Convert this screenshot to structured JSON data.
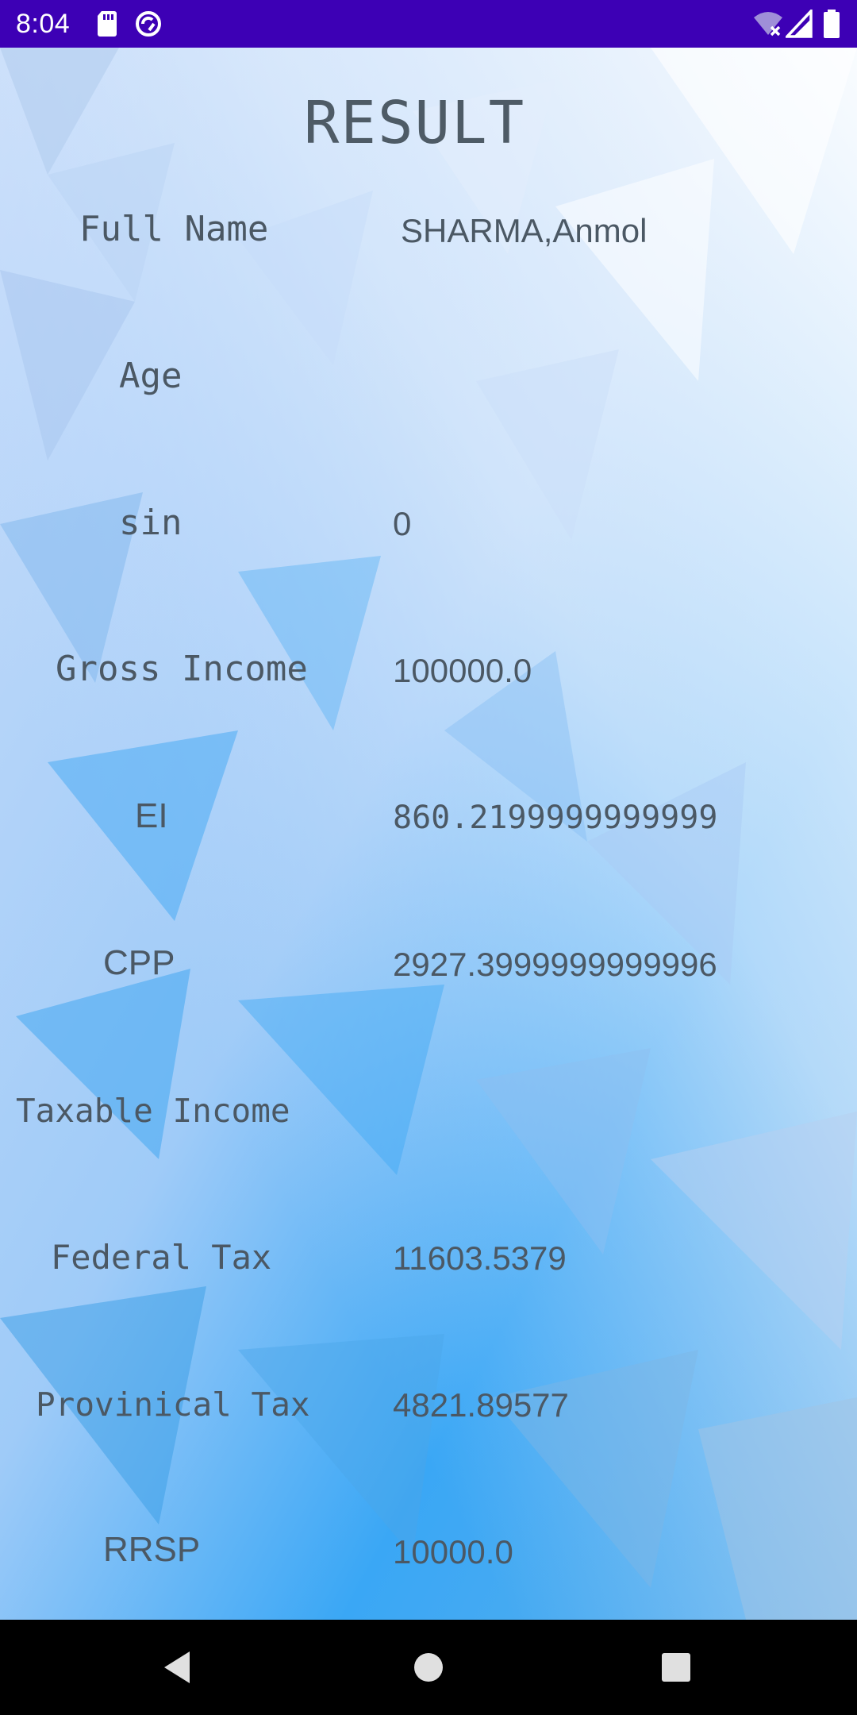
{
  "status_bar": {
    "time": "8:04",
    "icons": [
      "sd-card-icon",
      "sync-icon",
      "wifi-off-icon",
      "cell-signal-icon",
      "battery-icon"
    ]
  },
  "page": {
    "title": "RESULT"
  },
  "rows": [
    {
      "label": "Full Name",
      "value": "SHARMA,Anmol"
    },
    {
      "label": "Age",
      "value": ""
    },
    {
      "label": "sin",
      "value": "0"
    },
    {
      "label": "Gross Income",
      "value": "100000.0"
    },
    {
      "label": "EI",
      "value": "860.2199999999999"
    },
    {
      "label": "CPP",
      "value": "2927.3999999999996"
    },
    {
      "label": "Taxable Income",
      "value": ""
    },
    {
      "label": "Federal Tax",
      "value": "11603.5379"
    },
    {
      "label": "Provinical Tax",
      "value": "4821.89577"
    },
    {
      "label": "RRSP",
      "value": "10000.0"
    }
  ],
  "nav_bar": {
    "buttons": [
      "back-icon",
      "home-icon",
      "recents-icon"
    ]
  }
}
